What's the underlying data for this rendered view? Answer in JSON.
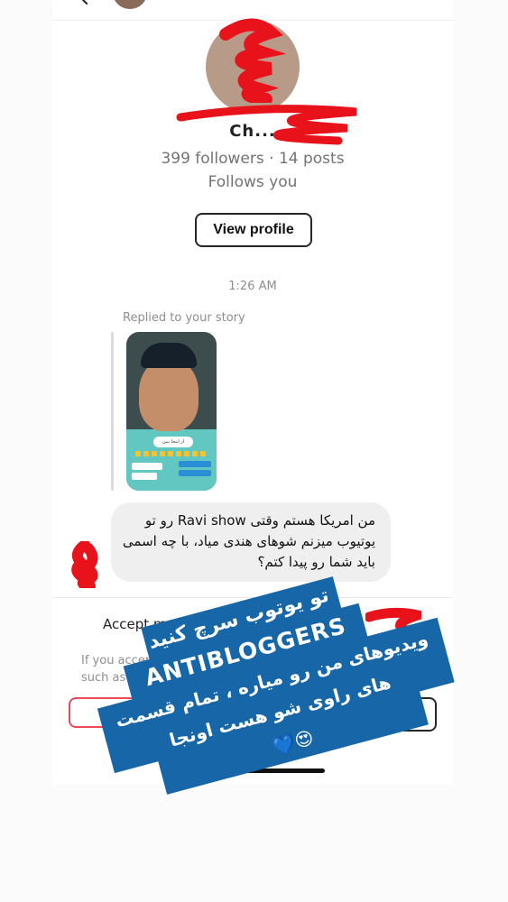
{
  "profile": {
    "name": "Ch...",
    "stats": "399 followers · 14 posts",
    "follows": "Follows you",
    "view_profile": "View profile"
  },
  "chat": {
    "time": "1:26 AM",
    "replied": "Replied to your story",
    "story_sticker": "از اینجا ببین",
    "message": "من امریکا هستم وقتی Ravi show رو تو یوتیوب میزنم شوهای هندی میاد، با چه اسمی باید شما رو پیدا کتم؟"
  },
  "request": {
    "accept_text": "Accept message re",
    "info_line1": "If you accep",
    "info_line2": "such as your",
    "block_label": "Bl"
  },
  "overlay": {
    "line1": "تو یوتوب سرچ کنید",
    "line2": "ANTIBLOGGERS",
    "line3": "ویدیوهای من رو میاره ، تمام قسمت",
    "line4": "های راوی شو هست اونجا",
    "line5": "😍💙",
    "color": "#1666a8"
  },
  "colors": {
    "scribble": "#e8121b",
    "block_red": "#ed4956"
  },
  "icons": [
    "back-arrow-icon",
    "heart-eyes-emoji",
    "blue-heart-emoji"
  ]
}
